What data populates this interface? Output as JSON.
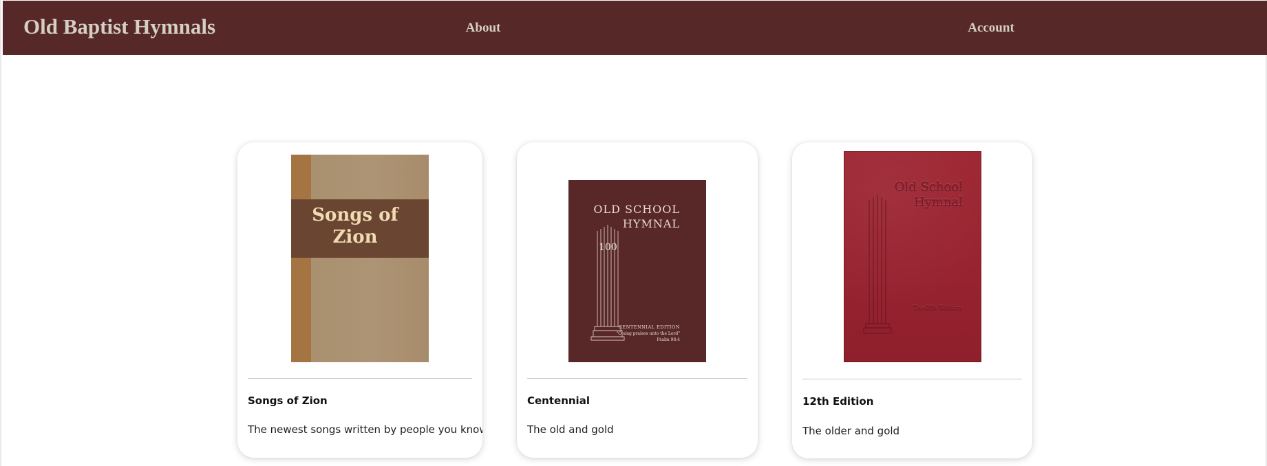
{
  "header": {
    "brand": "Old Baptist Hymnals",
    "nav": [
      {
        "label": "About"
      },
      {
        "label": "Account"
      }
    ]
  },
  "theme": {
    "header_bg": "#572828",
    "header_text": "#d4cfc4",
    "page_bg": "#ffffff"
  },
  "books": [
    {
      "title": "Songs of Zion",
      "description": "The newest songs written by people you know",
      "cover": {
        "title_lines": [
          "Songs of",
          "Zion"
        ],
        "colors": {
          "spine": "#a57443",
          "band": "#6a4632",
          "body": "#ad9474",
          "text": "#f1dbb2"
        }
      }
    },
    {
      "title": "Centennial",
      "description": "The old and gold",
      "cover": {
        "title_lines": [
          "OLD SCHOOL",
          "HYMNAL"
        ],
        "badge": "100",
        "edition": "CENTENNIAL EDITION",
        "quote": "\"O sing praises unto the Lord\"",
        "reference": "Psalm 98:4",
        "icon": "pillar-icon",
        "colors": {
          "body": "#582828",
          "text": "#e8dbd0"
        }
      }
    },
    {
      "title": "12th Edition",
      "description": "The older and gold",
      "cover": {
        "title_lines": [
          "Old School",
          "Hymnal"
        ],
        "edition": "Twelfth Edition",
        "icon": "pillar-icon",
        "colors": {
          "body": "#9e2733",
          "text": "#7b1924"
        }
      }
    }
  ]
}
